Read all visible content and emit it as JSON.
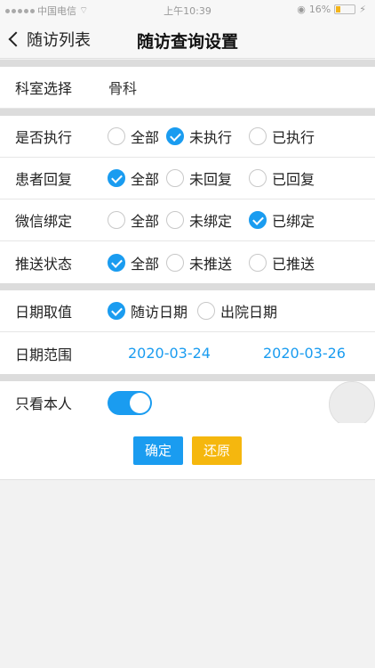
{
  "status_bar": {
    "carrier": "中国电信",
    "time": "上午10:39",
    "battery": "16%"
  },
  "nav": {
    "back_label": "随访列表",
    "title": "随访查询设置"
  },
  "department": {
    "label": "科室选择",
    "value": "骨科"
  },
  "executed": {
    "label": "是否执行",
    "options": [
      "全部",
      "未执行",
      "已执行"
    ],
    "selected": 1
  },
  "reply": {
    "label": "患者回复",
    "options": [
      "全部",
      "未回复",
      "已回复"
    ],
    "selected": 0
  },
  "wechat": {
    "label": "微信绑定",
    "options": [
      "全部",
      "未绑定",
      "已绑定"
    ],
    "selected": 2
  },
  "push": {
    "label": "推送状态",
    "options": [
      "全部",
      "未推送",
      "已推送"
    ],
    "selected": 0
  },
  "date_type": {
    "label": "日期取值",
    "options": [
      "随访日期",
      "出院日期"
    ],
    "selected": 0
  },
  "date_range": {
    "label": "日期范围",
    "start": "2020-03-24",
    "end": "2020-03-26"
  },
  "only_me": {
    "label": "只看本人",
    "on": true
  },
  "buttons": {
    "confirm": "确定",
    "reset": "还原"
  },
  "colors": {
    "accent": "#1a9cf0",
    "reset": "#f5b70e"
  }
}
